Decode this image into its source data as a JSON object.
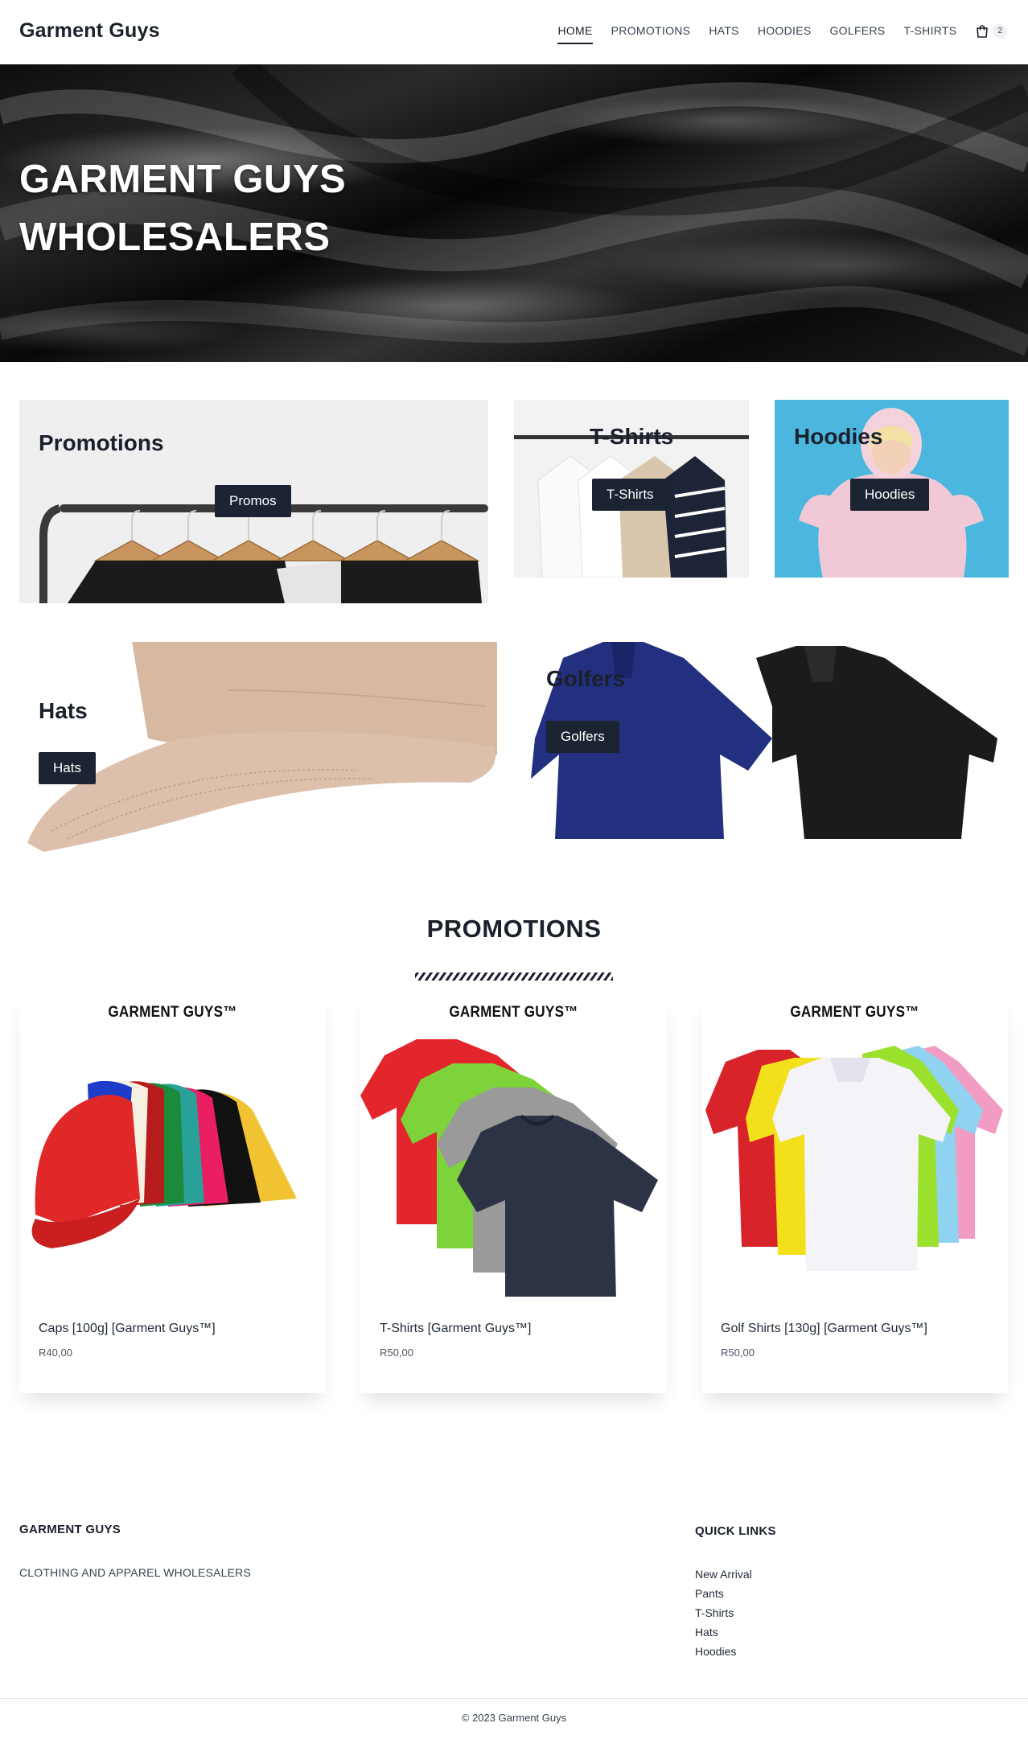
{
  "brand": "Garment Guys",
  "nav": {
    "items": [
      "HOME",
      "PROMOTIONS",
      "HATS",
      "HOODIES",
      "GOLFERS",
      "T-SHIRTS"
    ],
    "active": "HOME",
    "cart_count": "2"
  },
  "hero": {
    "title": "GARMENT GUYS WHOLESALERS"
  },
  "categories": {
    "promotions": {
      "title": "Promotions",
      "button": "Promos"
    },
    "tshirts": {
      "title": "T-Shirts",
      "button": "T-Shirts"
    },
    "hoodies": {
      "title": "Hoodies",
      "button": "Hoodies"
    },
    "hats": {
      "title": "Hats",
      "button": "Hats"
    },
    "golfers": {
      "title": "Golfers",
      "button": "Golfers"
    }
  },
  "promotions_section": {
    "title": "PROMOTIONS",
    "products": [
      {
        "brand": "GARMENT GUYS™",
        "name": "Caps [100g] [Garment Guys™]",
        "price": "R40,00"
      },
      {
        "brand": "GARMENT GUYS™",
        "name": "T-Shirts [Garment Guys™]",
        "price": "R50,00"
      },
      {
        "brand": "GARMENT GUYS™",
        "name": "Golf Shirts [130g] [Garment Guys™]",
        "price": "R50,00"
      }
    ]
  },
  "footer": {
    "about_heading": "GARMENT GUYS",
    "about_text": "CLOTHING AND APPAREL WHOLESALERS",
    "links_heading": "QUICK LINKS",
    "links": [
      "New Arrival",
      "Pants",
      "T-Shirts",
      "Hats",
      "Hoodies"
    ],
    "copyright": "© 2023 Garment Guys"
  },
  "colors": {
    "dark": "#1c2433",
    "accent_blue": "#4bb7df",
    "text": "#1a202c"
  }
}
